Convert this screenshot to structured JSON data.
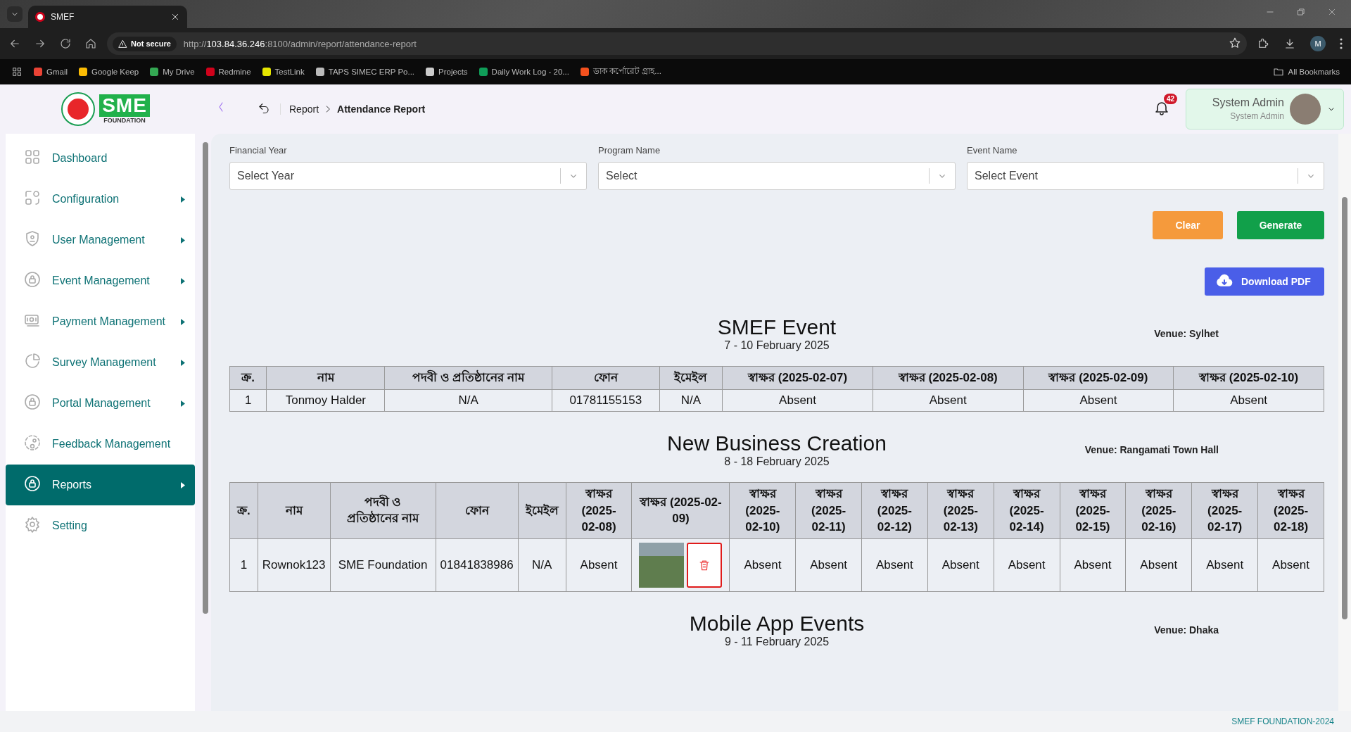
{
  "browser": {
    "tab_title": "SMEF",
    "security": "Not secure",
    "url_scheme": "http://",
    "url_host": "103.84.36.246",
    "url_path": ":8100/admin/report/attendance-report",
    "profile_initial": "M",
    "bookmarks": [
      {
        "label": "Gmail",
        "color": "#ea4335"
      },
      {
        "label": "Google Keep",
        "color": "#fbbc04"
      },
      {
        "label": "My Drive",
        "color": "#34a853"
      },
      {
        "label": "Redmine",
        "color": "#d0021b"
      },
      {
        "label": "TestLink",
        "color": "#e6e600"
      },
      {
        "label": "TAPS SIMEC ERP Po...",
        "color": "#bbbbbb"
      },
      {
        "label": "Projects",
        "color": "#cccccc"
      },
      {
        "label": "Daily Work Log - 20...",
        "color": "#0f9d58"
      },
      {
        "label": "ডাক কর্পোরেট গ্রাহ...",
        "color": "#f4511e"
      }
    ],
    "all_bookmarks": "All Bookmarks"
  },
  "logo": {
    "letters": "SME",
    "subtitle": "FOUNDATION"
  },
  "breadcrumb": {
    "parent": "Report",
    "current": "Attendance Report"
  },
  "notifications": {
    "count": "42"
  },
  "user": {
    "name": "System Admin",
    "role": "System Admin"
  },
  "sidebar": {
    "items": [
      {
        "label": "Dashboard",
        "has_submenu": false,
        "selected": false
      },
      {
        "label": "Configuration",
        "has_submenu": true,
        "selected": false
      },
      {
        "label": "User Management",
        "has_submenu": true,
        "selected": false
      },
      {
        "label": "Event Management",
        "has_submenu": true,
        "selected": false
      },
      {
        "label": "Payment Management",
        "has_submenu": true,
        "selected": false
      },
      {
        "label": "Survey Management",
        "has_submenu": true,
        "selected": false
      },
      {
        "label": "Portal Management",
        "has_submenu": true,
        "selected": false
      },
      {
        "label": "Feedback Management",
        "has_submenu": false,
        "selected": false
      },
      {
        "label": "Reports",
        "has_submenu": true,
        "selected": true
      },
      {
        "label": "Setting",
        "has_submenu": false,
        "selected": false
      }
    ]
  },
  "filters": [
    {
      "label": "Financial Year",
      "placeholder": "Select Year"
    },
    {
      "label": "Program Name",
      "placeholder": "Select"
    },
    {
      "label": "Event Name",
      "placeholder": "Select Event"
    }
  ],
  "buttons": {
    "clear": "Clear",
    "generate": "Generate",
    "download": "Download PDF"
  },
  "events": [
    {
      "title": "SMEF Event",
      "dates": "7 - 10 February 2025",
      "venue": "Venue: Sylhet",
      "columns": [
        "ক্র.",
        "নাম",
        "পদবী ও প্রতিষ্ঠানের নাম",
        "ফোন",
        "ইমেইল",
        "স্বাক্ষর (2025-02-07)",
        "স্বাক্ষর (2025-02-08)",
        "স্বাক্ষর (2025-02-09)",
        "স্বাক্ষর (2025-02-10)"
      ],
      "rows": [
        [
          {
            "kind": "text",
            "text": "1"
          },
          {
            "kind": "text",
            "text": "Tonmoy Halder"
          },
          {
            "kind": "text",
            "text": "N/A"
          },
          {
            "kind": "text",
            "text": "01781155153"
          },
          {
            "kind": "text",
            "text": "N/A"
          },
          {
            "kind": "text",
            "text": "Absent"
          },
          {
            "kind": "text",
            "text": "Absent"
          },
          {
            "kind": "text",
            "text": "Absent"
          },
          {
            "kind": "text",
            "text": "Absent"
          }
        ]
      ]
    },
    {
      "title": "New Business Creation",
      "dates": "8 - 18 February 2025",
      "venue": "Venue: Rangamati Town Hall",
      "columns": [
        "ক্র.",
        "নাম",
        "পদবী ও প্রতিষ্ঠানের নাম",
        "ফোন",
        "ইমেইল",
        "স্বাক্ষর (2025-02-08)",
        "স্বাক্ষর (2025-02-09)",
        "স্বাক্ষর (2025-02-10)",
        "স্বাক্ষর (2025-02-11)",
        "স্বাক্ষর (2025-02-12)",
        "স্বাক্ষর (2025-02-13)",
        "স্বাক্ষর (2025-02-14)",
        "স্বাক্ষর (2025-02-15)",
        "স্বাক্ষর (2025-02-16)",
        "স্বাক্ষর (2025-02-17)",
        "স্বাক্ষর (2025-02-18)"
      ],
      "rows": [
        [
          {
            "kind": "text",
            "text": "1"
          },
          {
            "kind": "text",
            "text": "Rownok123"
          },
          {
            "kind": "text",
            "text": "SME Foundation"
          },
          {
            "kind": "text",
            "text": "01841838986"
          },
          {
            "kind": "text",
            "text": "N/A"
          },
          {
            "kind": "text",
            "text": "Absent"
          },
          {
            "kind": "photo"
          },
          {
            "kind": "text",
            "text": "Absent"
          },
          {
            "kind": "text",
            "text": "Absent"
          },
          {
            "kind": "text",
            "text": "Absent"
          },
          {
            "kind": "text",
            "text": "Absent"
          },
          {
            "kind": "text",
            "text": "Absent"
          },
          {
            "kind": "text",
            "text": "Absent"
          },
          {
            "kind": "text",
            "text": "Absent"
          },
          {
            "kind": "text",
            "text": "Absent"
          },
          {
            "kind": "text",
            "text": "Absent"
          }
        ]
      ]
    },
    {
      "title": "Mobile App Events",
      "dates": "9 - 11 February 2025",
      "venue": "Venue: Dhaka"
    }
  ],
  "footer": "SMEF FOUNDATION-2024"
}
